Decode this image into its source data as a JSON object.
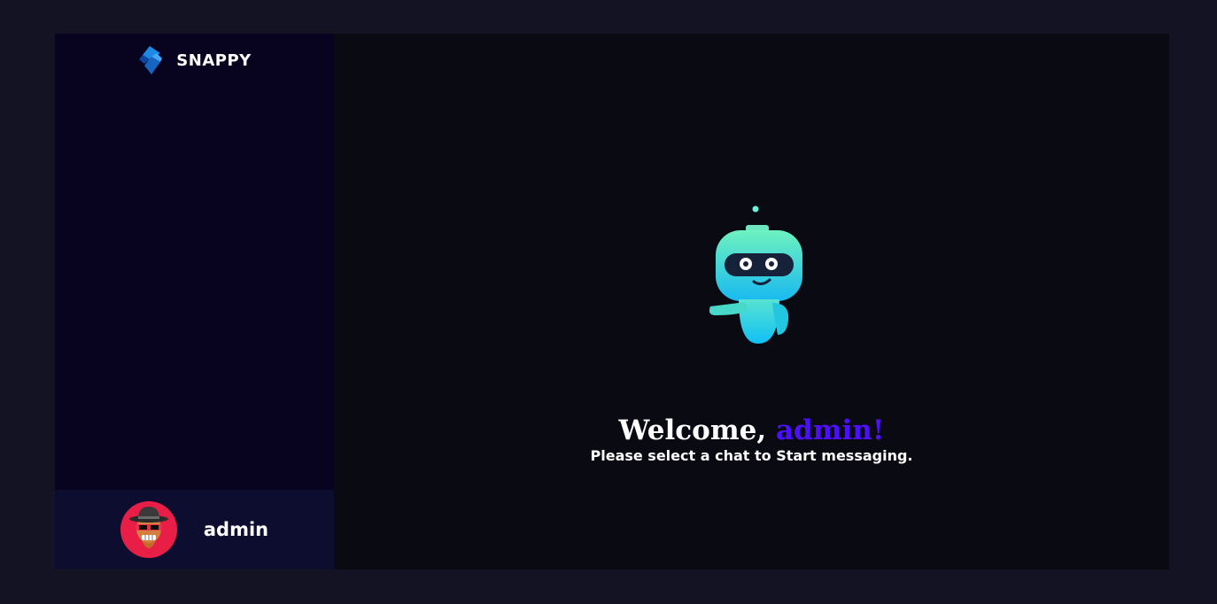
{
  "brand": {
    "name": "SNAPPY",
    "logo_icon": "snappy-logo-icon"
  },
  "sidebar": {
    "current_user": {
      "name": "admin",
      "avatar_icon": "sunglasses-hat-avatar-icon"
    }
  },
  "welcome": {
    "greeting": "Welcome, ",
    "username": "admin!",
    "subtitle": "Please select a chat to Start messaging.",
    "illustration_icon": "robot-icon"
  },
  "colors": {
    "page_bg": "#131324",
    "sidebar_bg": "#080420",
    "user_bar_bg": "#0d0d30",
    "chat_bg": "#0a0a12",
    "accent": "#4e0eff",
    "avatar_bg": "#e91e47"
  }
}
